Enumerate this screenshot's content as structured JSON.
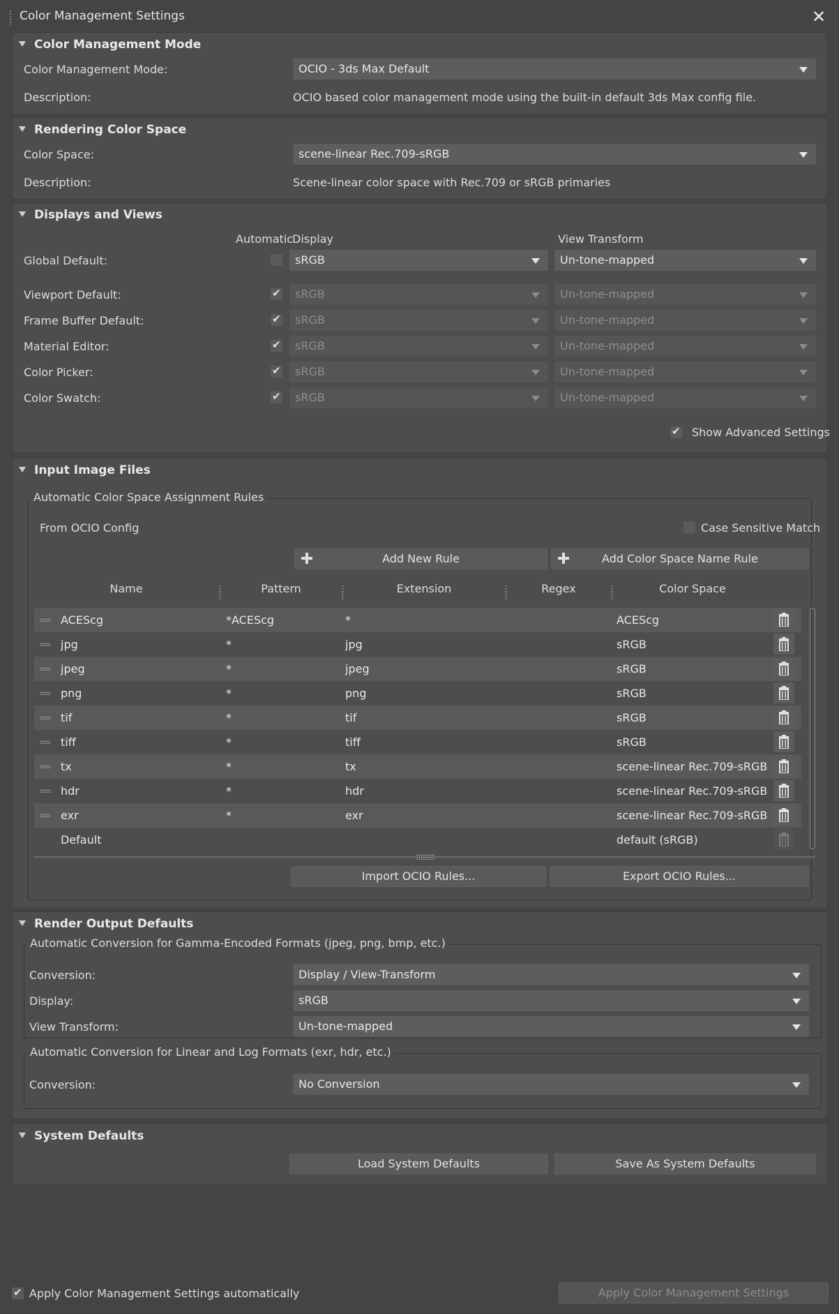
{
  "window": {
    "title": "Color Management Settings"
  },
  "cm_mode": {
    "header": "Color Management Mode",
    "mode_label": "Color Management Mode:",
    "mode_value": "OCIO - 3ds Max Default",
    "desc_label": "Description:",
    "desc_value": "OCIO based color management mode using the built-in default 3ds Max config file."
  },
  "rendering_cs": {
    "header": "Rendering Color Space",
    "cs_label": "Color Space:",
    "cs_value": "scene-linear Rec.709-sRGB",
    "desc_label": "Description:",
    "desc_value": "Scene-linear color space with Rec.709 or sRGB primaries"
  },
  "displays_views": {
    "header": "Displays and Views",
    "col_automatic": "Automatic",
    "col_display": "Display",
    "col_view": "View Transform",
    "rows": [
      {
        "label": "Global Default:",
        "automatic": false,
        "display": "sRGB",
        "view": "Un-tone-mapped"
      },
      {
        "label": "Viewport Default:",
        "automatic": true,
        "display": "sRGB",
        "view": "Un-tone-mapped"
      },
      {
        "label": "Frame Buffer Default:",
        "automatic": true,
        "display": "sRGB",
        "view": "Un-tone-mapped"
      },
      {
        "label": "Material Editor:",
        "automatic": true,
        "display": "sRGB",
        "view": "Un-tone-mapped"
      },
      {
        "label": "Color Picker:",
        "automatic": true,
        "display": "sRGB",
        "view": "Un-tone-mapped"
      },
      {
        "label": "Color Swatch:",
        "automatic": true,
        "display": "sRGB",
        "view": "Un-tone-mapped"
      }
    ],
    "show_advanced_label": "Show Advanced Settings",
    "show_advanced_checked": true
  },
  "input_images": {
    "header": "Input Image Files",
    "group_label": "Automatic Color Space Assignment Rules",
    "source_label": "From OCIO Config",
    "case_sensitive_label": "Case Sensitive Match",
    "case_sensitive_checked": false,
    "add_rule_label": "Add New Rule",
    "add_cs_rule_label": "Add Color Space Name Rule",
    "columns": [
      "Name",
      "Pattern",
      "Extension",
      "Regex",
      "Color Space"
    ],
    "rules": [
      {
        "name": "ACEScg",
        "pattern": "*ACEScg",
        "extension": "*",
        "regex": "",
        "color_space": "ACEScg"
      },
      {
        "name": "jpg",
        "pattern": "*",
        "extension": "jpg",
        "regex": "",
        "color_space": "sRGB"
      },
      {
        "name": "jpeg",
        "pattern": "*",
        "extension": "jpeg",
        "regex": "",
        "color_space": "sRGB"
      },
      {
        "name": "png",
        "pattern": "*",
        "extension": "png",
        "regex": "",
        "color_space": "sRGB"
      },
      {
        "name": "tif",
        "pattern": "*",
        "extension": "tif",
        "regex": "",
        "color_space": "sRGB"
      },
      {
        "name": "tiff",
        "pattern": "*",
        "extension": "tiff",
        "regex": "",
        "color_space": "sRGB"
      },
      {
        "name": "tx",
        "pattern": "*",
        "extension": "tx",
        "regex": "",
        "color_space": "scene-linear Rec.709-sRGB"
      },
      {
        "name": "hdr",
        "pattern": "*",
        "extension": "hdr",
        "regex": "",
        "color_space": "scene-linear Rec.709-sRGB"
      },
      {
        "name": "exr",
        "pattern": "*",
        "extension": "exr",
        "regex": "",
        "color_space": "scene-linear Rec.709-sRGB"
      },
      {
        "name": "Default",
        "pattern": "",
        "extension": "",
        "regex": "",
        "color_space": "default (sRGB)"
      }
    ],
    "import_label": "Import OCIO Rules...",
    "export_label": "Export OCIO Rules..."
  },
  "render_output": {
    "header": "Render Output Defaults",
    "gamma_group_label": "Automatic Conversion for Gamma-Encoded Formats (jpeg, png, bmp, etc.)",
    "conversion_label": "Conversion:",
    "conversion_value": "Display / View-Transform",
    "display_label": "Display:",
    "display_value": "sRGB",
    "view_label": "View Transform:",
    "view_value": "Un-tone-mapped",
    "linear_group_label": "Automatic Conversion for Linear and Log Formats (exr, hdr, etc.)",
    "linear_conversion_label": "Conversion:",
    "linear_conversion_value": "No Conversion"
  },
  "system_defaults": {
    "header": "System Defaults",
    "load_label": "Load System Defaults",
    "save_label": "Save As System Defaults"
  },
  "footer": {
    "auto_apply_label": "Apply Color Management Settings automatically",
    "auto_apply_checked": true,
    "apply_label": "Apply Color Management Settings"
  }
}
